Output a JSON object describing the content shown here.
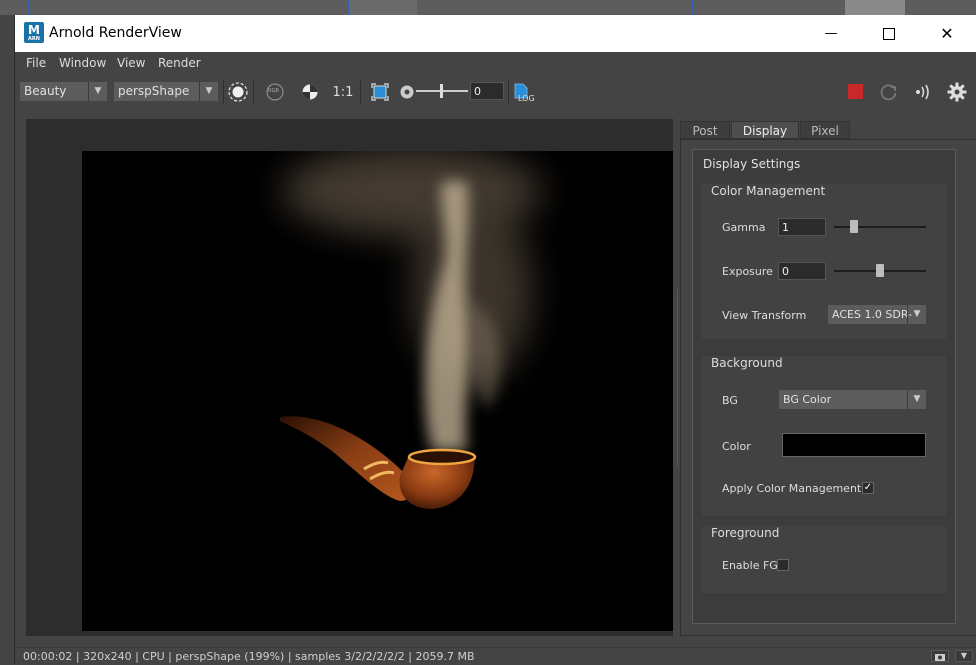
{
  "window": {
    "title": "Arnold RenderView",
    "app_icon_letter": "M",
    "app_icon_sub": "ARN",
    "minimize_glyph": "—",
    "maximize_glyph": "☐",
    "close_glyph": "✕"
  },
  "menubar": {
    "items": [
      "File",
      "Window",
      "View",
      "Render"
    ]
  },
  "toolbar": {
    "aov_select": "Beauty",
    "camera_select": "perspShape",
    "rgb_label": "RGB",
    "ratio_label": "1:1",
    "exposure_value": "0",
    "log_label": "LOG"
  },
  "tabs": [
    "Post",
    "Display",
    "Pixel"
  ],
  "active_tab": "Display",
  "display_settings": {
    "title": "Display Settings",
    "color_management": {
      "title": "Color Management",
      "gamma_label": "Gamma",
      "gamma_value": "1",
      "gamma_slider": 0.22,
      "exposure_label": "Exposure",
      "exposure_value": "0",
      "exposure_slider": 0.5,
      "view_transform_label": "View Transform",
      "view_transform_value": "ACES 1.0 SDR-"
    },
    "background": {
      "title": "Background",
      "bg_label": "BG",
      "bg_value": "BG Color",
      "color_label": "Color",
      "color_value": "#000000",
      "apply_cm_label": "Apply Color Management",
      "apply_cm_checked": true
    },
    "foreground": {
      "title": "Foreground",
      "enable_fg_label": "Enable FG",
      "enable_fg_checked": false
    }
  },
  "status": {
    "text": "00:00:02 |  320x240 | CPU | perspShape (199%) | samples 3/2/2/2/2/2 | 2059.7 MB"
  },
  "colors": {
    "accent_blue": "#1a73a8",
    "stop_red": "#c8282a",
    "panel_bg": "#444444"
  }
}
